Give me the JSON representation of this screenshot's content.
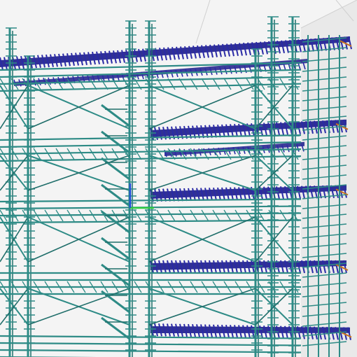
{
  "viewport": {
    "label": "",
    "colors": {
      "background": "#f4f4f4",
      "room_wall": "#e9e9e9",
      "room_edge": "#d0d0d0",
      "frame": "#2e8b86",
      "frame_dark": "#1f6e6a",
      "deck": "#1c1c8a",
      "deck_light": "#2a2aa6",
      "accent_orange": "#c8731e",
      "axis_x": "#2ecc40",
      "axis_y": "#1f4fd6"
    }
  }
}
